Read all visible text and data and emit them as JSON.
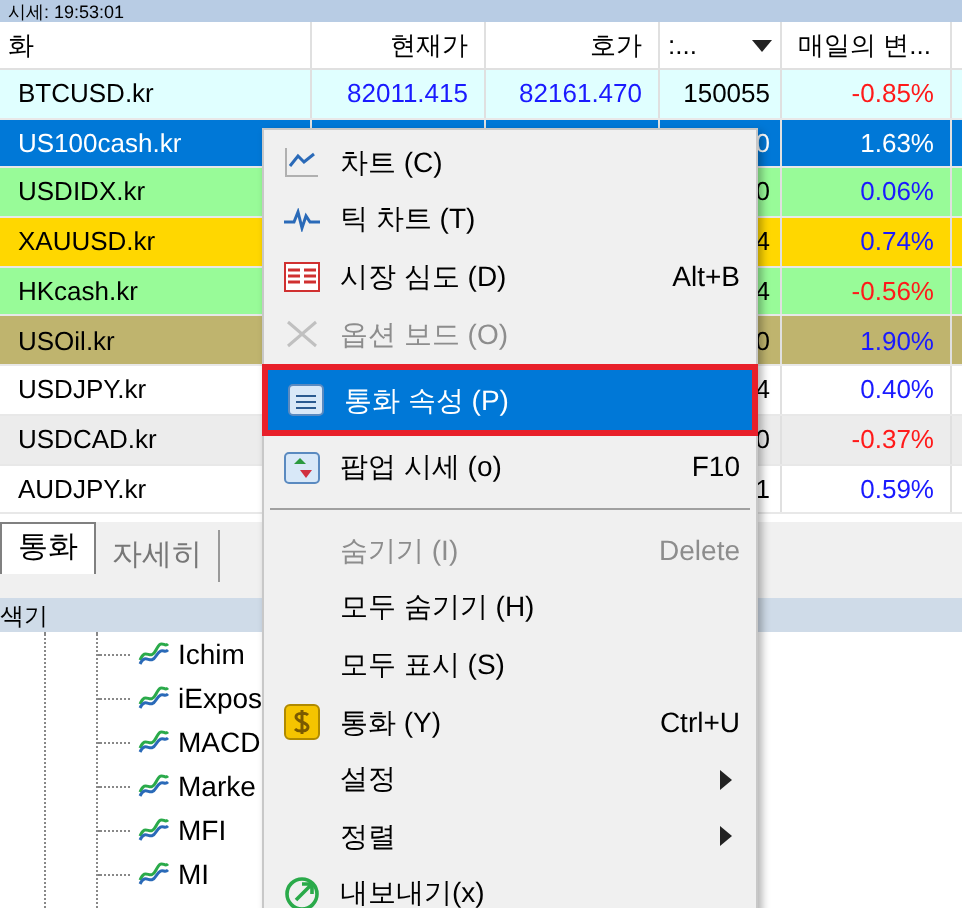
{
  "title_strip": "시세: 19:53:01",
  "table": {
    "columns": [
      {
        "label": "화"
      },
      {
        "label": "현재가"
      },
      {
        "label": "호가"
      },
      {
        "label": ":...",
        "sort": true
      },
      {
        "label": "매일의 변..."
      }
    ],
    "rows": [
      {
        "symbol": "BTCUSD.kr",
        "bid": "82011.415",
        "ask": "82161.470",
        "col4": "150055",
        "change": {
          "text": "-0.85%",
          "color": "#ff1a1a"
        },
        "color": "#e0ffff",
        "selected": false
      },
      {
        "symbol": "US100cash.kr",
        "col4": "0",
        "change": {
          "text": "1.63%",
          "color": "#ffffff"
        },
        "color": "#0078d7",
        "selected": true
      },
      {
        "symbol": "USDIDX.kr",
        "col4": "0",
        "change": {
          "text": "0.06%",
          "color": "#1a1aff"
        },
        "color": "#98fb98",
        "selected": false
      },
      {
        "symbol": "XAUUSD.kr",
        "col4": "4",
        "change": {
          "text": "0.74%",
          "color": "#1a1aff"
        },
        "color": "#ffd700",
        "selected": false
      },
      {
        "symbol": "HKcash.kr",
        "col4": "4",
        "change": {
          "text": "-0.56%",
          "color": "#ff1a1a"
        },
        "color": "#98fb98",
        "selected": false
      },
      {
        "symbol": "USOil.kr",
        "col4": "0",
        "change": {
          "text": "1.90%",
          "color": "#1a1aff"
        },
        "color": "#bfb46e",
        "selected": false
      },
      {
        "symbol": "USDJPY.kr",
        "col4": "4",
        "change": {
          "text": "0.40%",
          "color": "#1a1aff"
        },
        "color": "#ffffff",
        "selected": false
      },
      {
        "symbol": "USDCAD.kr",
        "col4": "0",
        "change": {
          "text": "-0.37%",
          "color": "#ff1a1a"
        },
        "color": "#ececec",
        "selected": false
      },
      {
        "symbol": "AUDJPY.kr",
        "col4": "1",
        "change": {
          "text": "0.59%",
          "color": "#1a1aff"
        },
        "color": "#ffffff",
        "selected": false
      }
    ]
  },
  "tabs": [
    {
      "label": "통화",
      "selected": true
    },
    {
      "label": "자세히",
      "selected": false
    }
  ],
  "navigator": {
    "title": "색기",
    "items": [
      "Ichim",
      "iExpos",
      "MACD",
      "Marke",
      "MFI",
      "MI"
    ]
  },
  "menu": [
    {
      "kind": "item",
      "label": "차트 (C)",
      "disabled": false,
      "selected": false
    },
    {
      "kind": "item",
      "label": "틱 차트 (T)",
      "disabled": false,
      "selected": false
    },
    {
      "kind": "item",
      "label": "시장 심도 (D)",
      "shortcut": "Alt+B",
      "disabled": false,
      "selected": false
    },
    {
      "kind": "item",
      "label": "옵션 보드 (O)",
      "disabled": true,
      "selected": false
    },
    {
      "kind": "item",
      "label": "통화 속성 (P)",
      "disabled": false,
      "selected": true
    },
    {
      "kind": "item",
      "label": "팝업 시세 (o)",
      "shortcut": "F10",
      "disabled": false,
      "selected": false
    },
    {
      "kind": "separator"
    },
    {
      "kind": "item",
      "label": "숨기기 (I)",
      "shortcut": "Delete",
      "disabled": true,
      "selected": false
    },
    {
      "kind": "item",
      "label": "모두 숨기기 (H)",
      "disabled": false,
      "selected": false
    },
    {
      "kind": "item",
      "label": "모두 표시 (S)",
      "disabled": false,
      "selected": false
    },
    {
      "kind": "item",
      "label": "통화 (Y)",
      "shortcut": "Ctrl+U",
      "disabled": false,
      "selected": false
    },
    {
      "kind": "submenu",
      "label": "설정",
      "disabled": false,
      "selected": false
    },
    {
      "kind": "submenu",
      "label": "정렬",
      "disabled": false,
      "selected": false
    },
    {
      "kind": "item",
      "label": "내보내기(x)",
      "disabled": false,
      "selected": false
    }
  ]
}
